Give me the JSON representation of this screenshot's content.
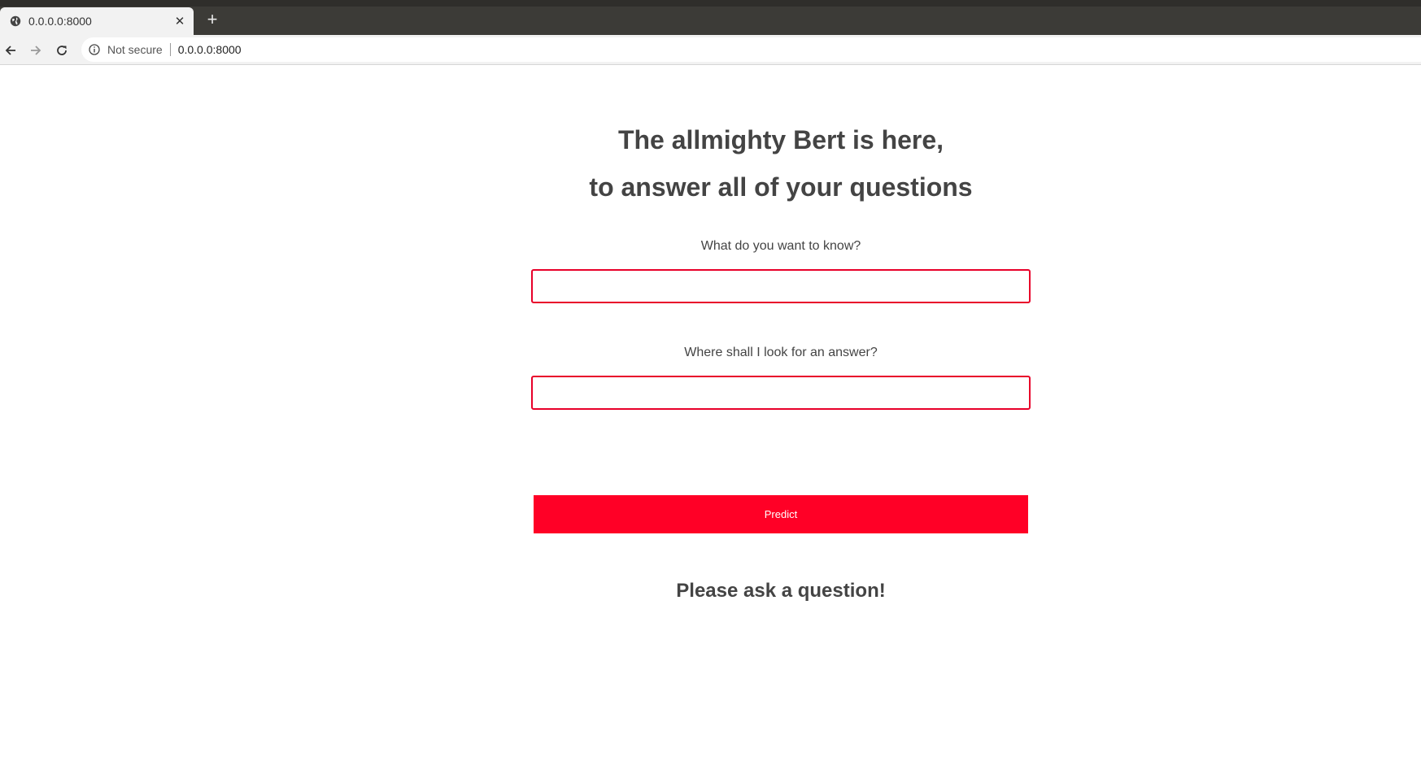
{
  "browser": {
    "tab_title": "0.0.0.0:8000",
    "new_tab_symbol": "+",
    "close_symbol": "✕",
    "security_label": "Not secure",
    "url": "0.0.0.0:8000"
  },
  "page": {
    "heading_line1": "The allmighty Bert is here,",
    "heading_line2": "to answer all of your questions",
    "question_label": "What do you want to know?",
    "question_value": "",
    "context_label": "Where shall I look for an answer?",
    "context_value": "",
    "predict_label": "Predict",
    "result_text": "Please ask a question!"
  },
  "colors": {
    "accent": "#ff0026",
    "input_border": "#e8002a",
    "text": "#444444"
  }
}
